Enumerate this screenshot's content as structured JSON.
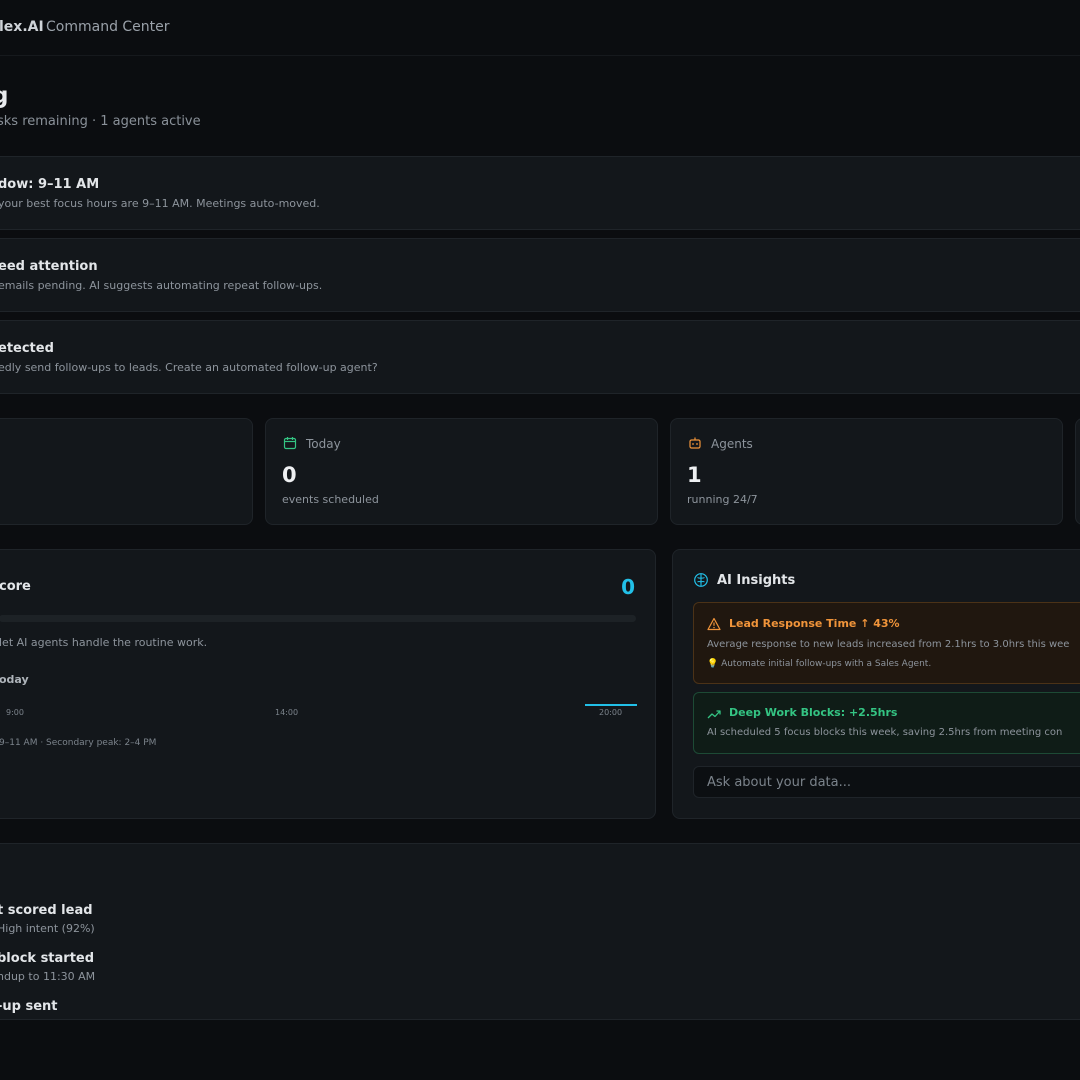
{
  "topbar": {
    "brand": "lex.AI",
    "section": "Command Center"
  },
  "greeting": {
    "title": "g",
    "subtitle": "sks remaining · 1 agents active"
  },
  "banners": [
    {
      "title": "dow: 9–11 AM",
      "description": " your best focus hours are 9–11 AM. Meetings auto-moved."
    },
    {
      "title": "eed attention",
      "description": " emails pending. AI suggests automating repeat follow-ups."
    },
    {
      "title": "etected",
      "description": "edly send follow-ups to leads. Create an automated follow-up agent?"
    }
  ],
  "stats": {
    "today": {
      "label": "Today",
      "value": "0",
      "note": "events scheduled",
      "icon": "calendar-icon",
      "icon_color": "#34c483"
    },
    "agents": {
      "label": "Agents",
      "value": "1",
      "note": "running 24/7",
      "icon": "robot-icon",
      "icon_color": "#f0943a"
    }
  },
  "score": {
    "title": "core",
    "value": "0",
    "progress": 0,
    "description": " let AI agents handle the routine work.",
    "energy_title": "oday",
    "ticks": [
      "9:00",
      "14:00",
      "20:00"
    ],
    "peak_note": "9–11 AM · Secondary peak: 2–4 PM",
    "accent": "#22c0e8"
  },
  "insights": {
    "title": "AI Insights",
    "icon": "brain-icon",
    "items": [
      {
        "kind": "warning",
        "icon": "alert-triangle-icon",
        "title": "Lead Response Time ↑ 43%",
        "description": "Average response to new leads increased from 2.1hrs to 3.0hrs this wee",
        "tip": "💡 Automate initial follow-ups with a Sales Agent.",
        "color": "#f0943a"
      },
      {
        "kind": "positive",
        "icon": "trending-up-icon",
        "title": "Deep Work Blocks: +2.5hrs",
        "description": "AI scheduled 5 focus blocks this week, saving 2.5hrs from meeting con",
        "color": "#34c483"
      }
    ],
    "ask_placeholder": "Ask about your data..."
  },
  "activity": [
    {
      "title": "t scored lead",
      "description": " High intent (92%)"
    },
    {
      "title": "block started",
      "description": "ndup to 11:30 AM"
    },
    {
      "title": "-up sent",
      "description": ""
    }
  ]
}
